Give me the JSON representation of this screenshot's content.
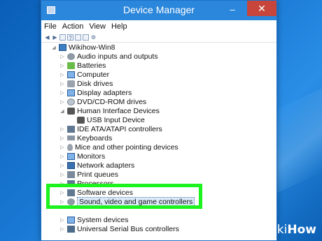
{
  "window": {
    "title": "Device Manager"
  },
  "menu": [
    "File",
    "Action",
    "View",
    "Help"
  ],
  "toolbar_icons": [
    "back-icon",
    "forward-icon",
    "properties-icon",
    "help-icon",
    "scan-icon",
    "monitor-icon",
    "update-driver-icon"
  ],
  "tree": {
    "root": "Wikihow-Win8",
    "items": [
      {
        "label": "Audio inputs and outputs",
        "icon": "speaker-icon"
      },
      {
        "label": "Batteries",
        "icon": "battery-icon"
      },
      {
        "label": "Computer",
        "icon": "computer-icon"
      },
      {
        "label": "Disk drives",
        "icon": "disk-icon"
      },
      {
        "label": "Display adapters",
        "icon": "monitor-icon"
      },
      {
        "label": "DVD/CD-ROM drives",
        "icon": "cd-icon"
      },
      {
        "label": "Human Interface Devices",
        "icon": "hid-icon"
      },
      {
        "label": "USB Input Device",
        "icon": "hid-icon"
      },
      {
        "label": "IDE ATA/ATAPI controllers",
        "icon": "chip-icon"
      },
      {
        "label": "Keyboards",
        "icon": "keyboard-icon"
      },
      {
        "label": "Mice and other pointing devices",
        "icon": "mouse-icon"
      },
      {
        "label": "Monitors",
        "icon": "monitor-icon"
      },
      {
        "label": "Network adapters",
        "icon": "network-icon"
      },
      {
        "label": "Print queues",
        "icon": "printer-icon"
      },
      {
        "label": "Processors",
        "icon": "chip-icon"
      },
      {
        "label": "Software devices",
        "icon": "chip-icon"
      },
      {
        "label": "Sound, video and game controllers",
        "icon": "speaker-icon"
      },
      {
        "label": "System devices",
        "icon": "monitor-icon"
      },
      {
        "label": "Universal Serial Bus controllers",
        "icon": "usb-icon"
      }
    ]
  },
  "watermark": {
    "brand": "wiki",
    "suffix": "How"
  },
  "colors": {
    "highlight": "#1cf21c",
    "titlebar": "#2b87dc",
    "close": "#c7453a"
  }
}
